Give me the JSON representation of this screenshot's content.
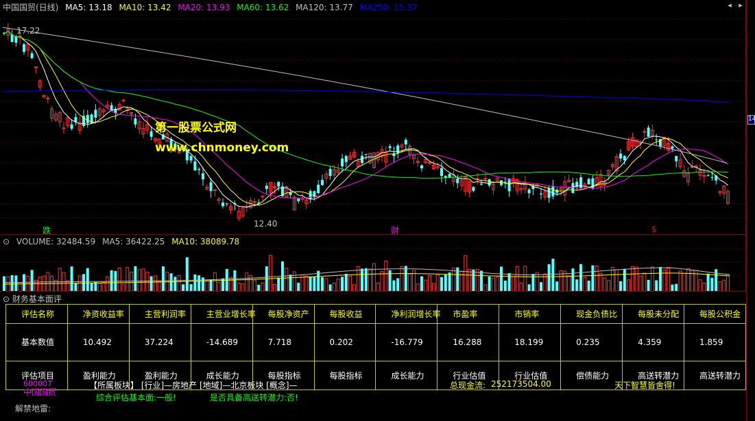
{
  "price_chart": {
    "title": "中国国贸(日线)",
    "ma_labels": [
      {
        "text": "MA5: 13.18",
        "color": "#ffffff"
      },
      {
        "text": "MA10: 13.42",
        "color": "#ffff00"
      },
      {
        "text": "MA20: 13.93",
        "color": "#ff00ff"
      },
      {
        "text": "MA60: 13.62",
        "color": "#00ff00"
      },
      {
        "text": "MA120: 13.77",
        "color": "#c0c0c0"
      },
      {
        "text": "MA250: 15.37",
        "color": "#0000ff"
      }
    ],
    "high_label": "17.22",
    "low_label": "12.40",
    "right_scale_label": "14",
    "watermark_cn": "第一股票公式网",
    "watermark_url": "www.chnmoney.com",
    "signals": [
      {
        "text": "跌",
        "color": "#00ff00"
      },
      {
        "text": "财",
        "color": "#ff00ff"
      },
      {
        "text": "$",
        "color": "#ff0000"
      }
    ],
    "window_controls": {
      "prev": "◂",
      "next": "▸"
    }
  },
  "volume_chart": {
    "labels": [
      {
        "text": "VOLUME: 32484.59",
        "color": "#c0c0c0"
      },
      {
        "text": "MA5: 36422.25",
        "color": "#c0c0c0"
      },
      {
        "text": "MA10: 38089.78",
        "color": "#ffff00"
      }
    ]
  },
  "financial_panel": {
    "title": "财务基本面评",
    "table": {
      "headers": [
        "评估名称",
        "净资收益率",
        "主营利润率",
        "主营业增长率",
        "每股净资产",
        "每股收益",
        "净利润增长率",
        "市盈率",
        "市销率",
        "现金负债比",
        "每股未分配",
        "每股公积金"
      ],
      "values": [
        "基本数值",
        "10.492",
        "37.224",
        "-14.689",
        "7.718",
        "0.202",
        "-16.779",
        "16.288",
        "18.199",
        "0.235",
        "4.359",
        "1.859"
      ],
      "categories": [
        "评估项目",
        "盈利能力",
        "盈利能力",
        "成长能力",
        "每股指标",
        "每股指标",
        "成长能力",
        "行业估值",
        "行业估值",
        "偿债能力",
        "高送转潜力",
        "高送转潜力"
      ]
    },
    "stock_code": "600007",
    "stock_name": "中国国贸",
    "sector_info": "【所属板块】 [行业]—房地产 [地域]—北京板块 [概念]—",
    "total_cash_label": "总现金流:",
    "total_cash_value": "252173504.00",
    "slogan": "天下智慧皆舍得!",
    "evaluation": "综合评估基本面:一般!",
    "high_transfer": "是否具备高送转潜力:否!",
    "unlock_label": "解禁地雷:"
  },
  "colors": {
    "up_candle": "#ff3232",
    "down_candle": "#54ffff",
    "grid": "#5a0000"
  }
}
